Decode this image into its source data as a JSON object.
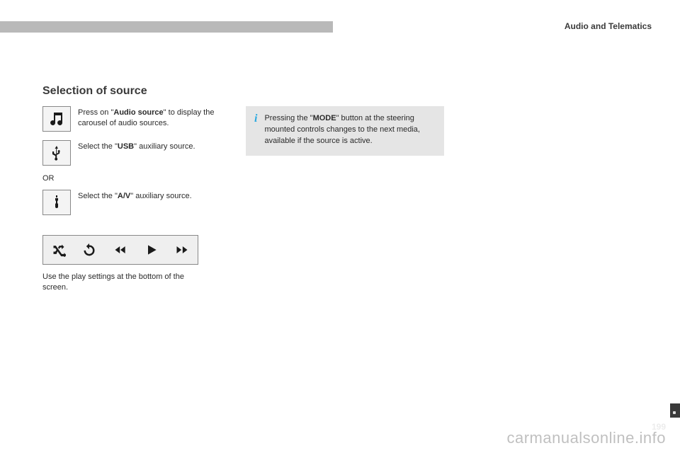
{
  "header": {
    "category": "Audio and Telematics"
  },
  "section": {
    "title": "Selection of source"
  },
  "rows": {
    "audio_source": {
      "text_a": "Press on \"",
      "text_b": "Audio source",
      "text_c": "\" to display the carousel of audio sources."
    },
    "usb": {
      "text_a": "Select the \"",
      "text_b": "USB",
      "text_c": "\" auxiliary source."
    },
    "or": "OR",
    "av": {
      "text_a": "Select the \"",
      "text_b": "A/V",
      "text_c": "\" auxiliary source."
    }
  },
  "caption": "Use the play settings at the bottom of the screen.",
  "info": {
    "pre": "Pressing the \"",
    "bold": "MODE",
    "post": "\" button at the steering mounted controls changes to the next media, available if the source is active."
  },
  "watermark": "carmanualsonline.info",
  "page_hint": "199"
}
